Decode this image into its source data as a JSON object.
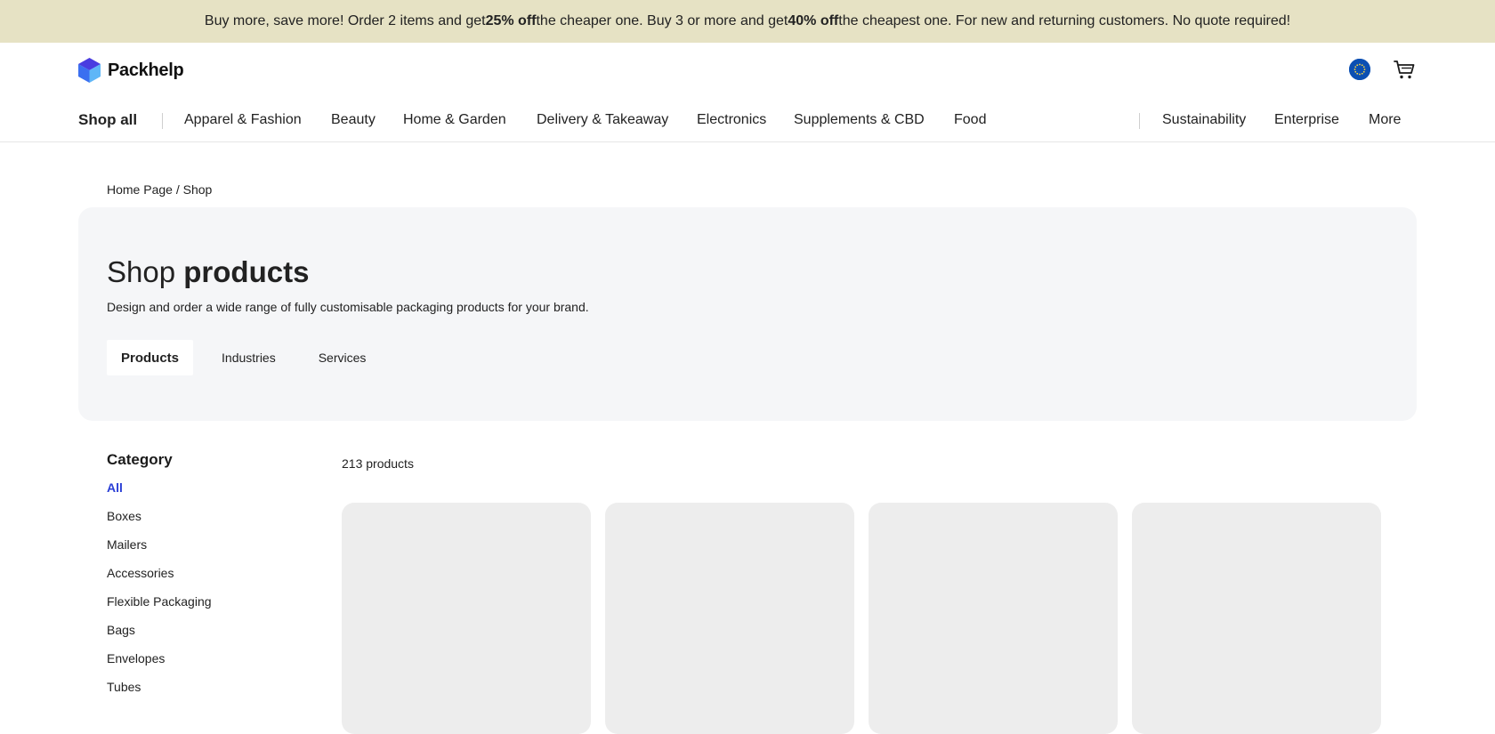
{
  "promo": {
    "part1": "Buy more, save more! Order 2 items and get ",
    "bold1": "25% off",
    "part2": " the cheaper one. Buy 3 or more and get ",
    "bold2": "40% off",
    "part3": " the cheapest one. For new and returning customers. No quote required!",
    "background_color": "#e6e2c4"
  },
  "header": {
    "logo_text": "Packhelp",
    "logo_icon": "packhelp-cube-logo",
    "region_icon": "eu-flag-icon",
    "cart_icon": "cart-icon"
  },
  "nav": {
    "shop_all": "Shop all",
    "categories": [
      "Apparel & Fashion",
      "Beauty",
      "Home & Garden",
      "Delivery & Takeaway",
      "Electronics",
      "Supplements & CBD",
      "Food"
    ],
    "secondary": [
      "Sustainability",
      "Enterprise",
      "More"
    ]
  },
  "breadcrumb": {
    "home": "Home Page",
    "separator": " / ",
    "current": "Shop"
  },
  "hero": {
    "title_light": "Shop ",
    "title_bold": "products",
    "description": "Design and order a wide range of fully customisable packaging products for your brand.",
    "tabs": [
      "Products",
      "Industries",
      "Services"
    ],
    "active_tab": "Products"
  },
  "sidebar": {
    "title": "Category",
    "items": [
      "All",
      "Boxes",
      "Mailers",
      "Accessories",
      "Flexible Packaging",
      "Bags",
      "Envelopes",
      "Tubes"
    ],
    "active_item": "All",
    "accent_color": "#2a3fd6"
  },
  "products": {
    "count_label": "213 products"
  }
}
